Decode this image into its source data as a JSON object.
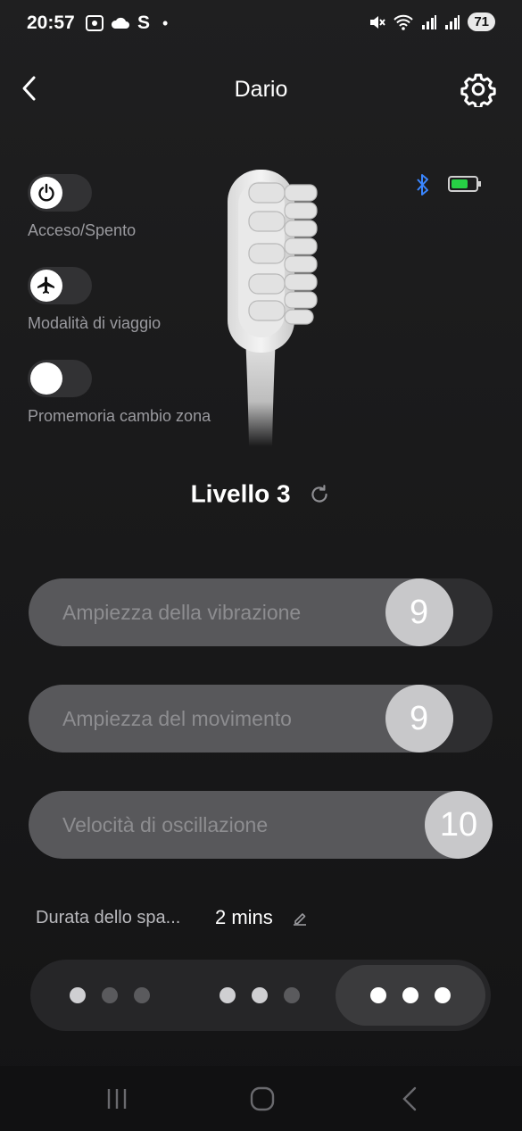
{
  "status_bar": {
    "time": "20:57",
    "battery": "71",
    "icons": [
      "screenshot-icon",
      "cloud-icon",
      "s-app-icon",
      "dot-icon",
      "mute-icon",
      "wifi-icon",
      "signal-icon",
      "signal-icon"
    ]
  },
  "header": {
    "title": "Dario"
  },
  "toggles": [
    {
      "label": "Acceso/Spento",
      "icon": "power-icon",
      "on": false
    },
    {
      "label": "Modalità di viaggio",
      "icon": "airplane-icon",
      "on": false
    },
    {
      "label": "Promemoria cambio zona",
      "icon": "",
      "on": false
    }
  ],
  "device": {
    "bluetooth": "bluetooth-icon",
    "battery_color": "#27d045"
  },
  "level": {
    "label": "Livello 3"
  },
  "sliders": [
    {
      "label": "Ampiezza della vibrazione",
      "value": "9",
      "fraction": 0.9
    },
    {
      "label": "Ampiezza del movimento",
      "value": "9",
      "fraction": 0.9
    },
    {
      "label": "Velocità di oscillazione",
      "value": "10",
      "fraction": 1.0
    }
  ],
  "duration": {
    "label": "Durata dello spa...",
    "value": "2 mins"
  },
  "modes": {
    "selected_index": 2,
    "levels": [
      1,
      2,
      3
    ]
  }
}
